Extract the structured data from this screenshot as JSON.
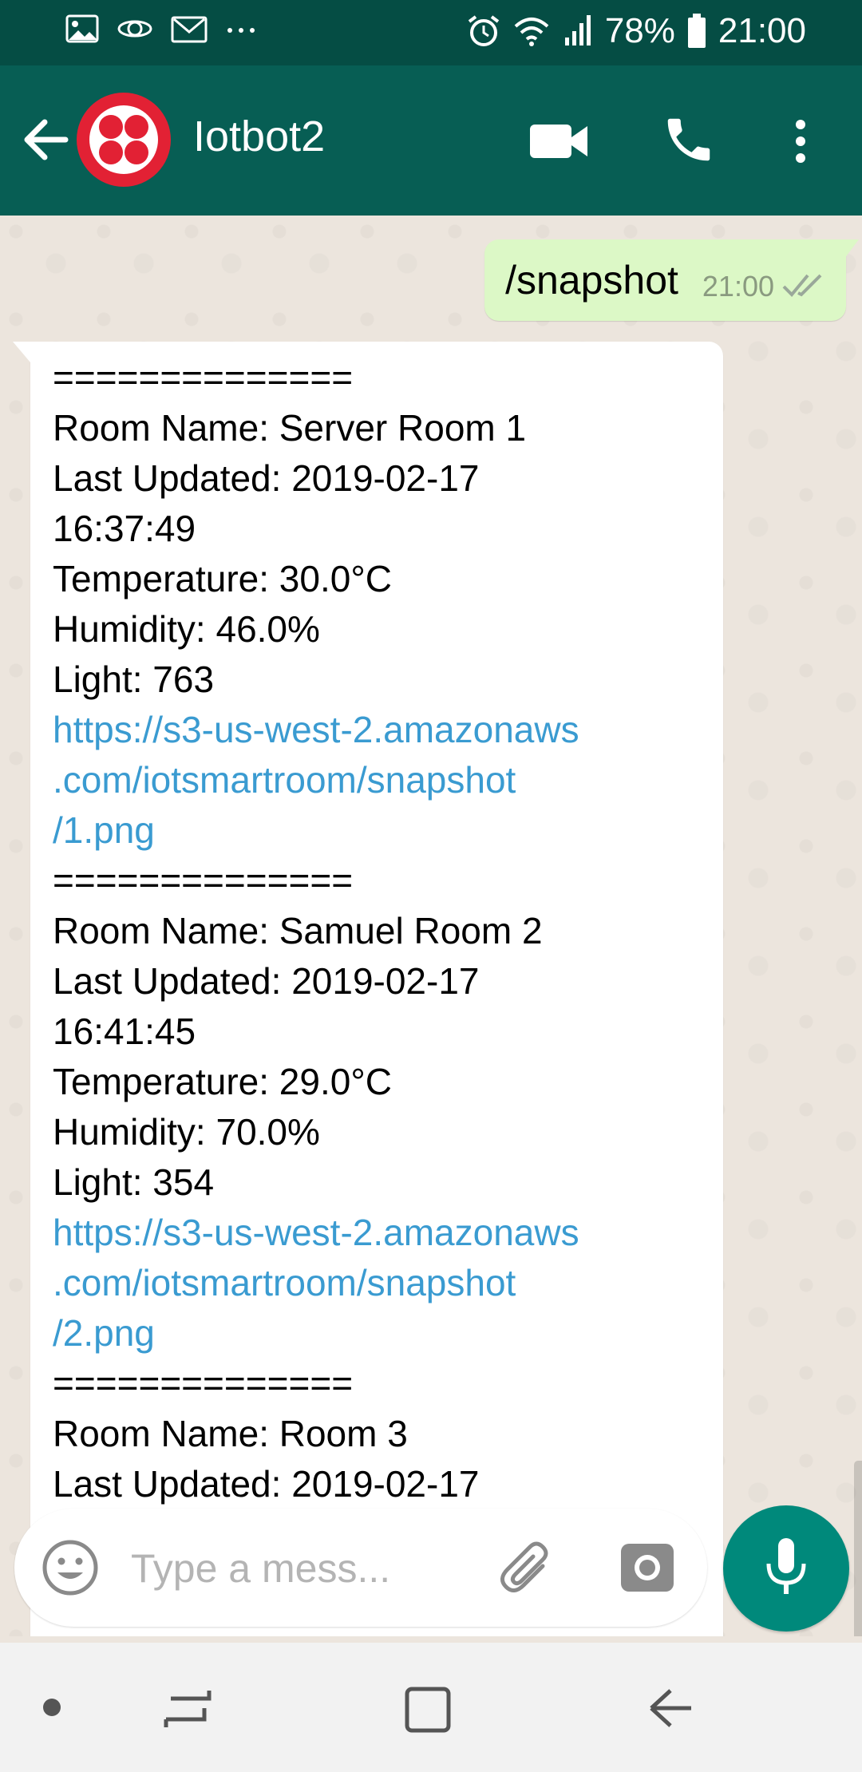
{
  "status_bar": {
    "left_icons": [
      "image-icon",
      "cloud-sync-icon",
      "mail-icon",
      "more-dots-icon"
    ],
    "battery": "78%",
    "time": "21:00"
  },
  "header": {
    "title": "Iotbot2",
    "avatar_color": "#e22134",
    "bar_color": "#075e54"
  },
  "messages": {
    "outgoing": {
      "text": "/snapshot",
      "time": "21:00",
      "status_icon": "double-check-icon"
    },
    "incoming": {
      "lines": [
        {
          "type": "text",
          "value": "=============="
        },
        {
          "type": "text",
          "value": "Room Name: Server Room 1"
        },
        {
          "type": "text",
          "value": "Last Updated: 2019-02-17"
        },
        {
          "type": "text",
          "value": "16:37:49"
        },
        {
          "type": "text",
          "value": "Temperature: 30.0°C"
        },
        {
          "type": "text",
          "value": "Humidity: 46.0%"
        },
        {
          "type": "text",
          "value": "Light: 763"
        },
        {
          "type": "link",
          "value": "https://s3-us-west-2.amazonaws"
        },
        {
          "type": "link",
          "value": ".com/iotsmartroom/snapshot"
        },
        {
          "type": "link",
          "value": "/1.png"
        },
        {
          "type": "text",
          "value": "=============="
        },
        {
          "type": "text",
          "value": "Room Name: Samuel Room 2"
        },
        {
          "type": "text",
          "value": "Last Updated: 2019-02-17"
        },
        {
          "type": "text",
          "value": "16:41:45"
        },
        {
          "type": "text",
          "value": "Temperature: 29.0°C"
        },
        {
          "type": "text",
          "value": "Humidity: 70.0%"
        },
        {
          "type": "text",
          "value": "Light: 354"
        },
        {
          "type": "link",
          "value": "https://s3-us-west-2.amazonaws"
        },
        {
          "type": "link",
          "value": ".com/iotsmartroom/snapshot"
        },
        {
          "type": "link",
          "value": "/2.png"
        },
        {
          "type": "text",
          "value": "=============="
        },
        {
          "type": "text",
          "value": "Room Name: Room 3"
        },
        {
          "type": "text",
          "value": "Last Updated: 2019-02-17"
        }
      ],
      "link_color": "#3a9bd1"
    }
  },
  "composer": {
    "placeholder": "Type a mess...",
    "mic_color": "#00897b"
  }
}
